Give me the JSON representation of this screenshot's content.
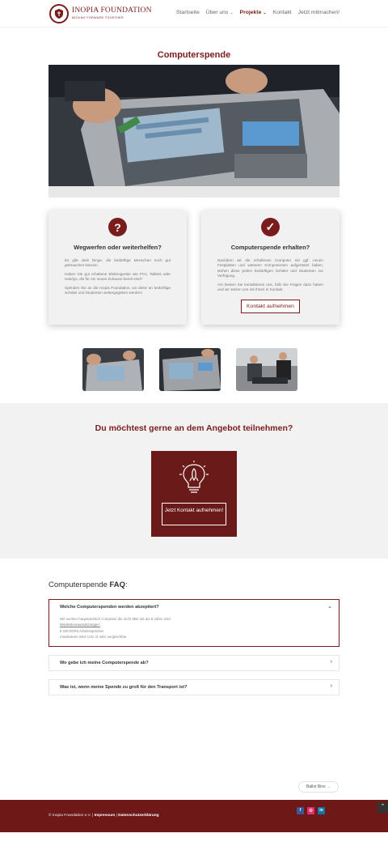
{
  "header": {
    "logo_title": "INOPIA FOUNDATION",
    "logo_subtitle": "MOVING FORWARD TOGETHER",
    "nav": [
      "Startseite",
      "Über uns",
      "Projekte",
      "Kontakt",
      "Jetzt mitmachen!"
    ]
  },
  "page_title": "Computerspende",
  "cards": {
    "left": {
      "icon": "question-icon",
      "title": "Wegwerfen oder weiterhelfen?",
      "p1": "Es gibt viele Dinge, die bedürftige Menschen noch gut gebrauchen können.",
      "p2": "Haben Sie gut erhaltene Elektrogeräte wie PCs, Tablets oder Handys, die für ein neues Zuhause bereit sind?",
      "p3": "Spenden Sie an die Inopia Foundation, wo diese an bedürftige Schüler und Studenten weitergegeben werden!"
    },
    "right": {
      "icon": "check-icon",
      "title": "Computerspende erhalten?",
      "p1": "Nachdem wir die erhaltenen Computer mit ggf. neuen Festplatten und weiteren Komponenten aufgerüstet haben, stehen diese jedem bedürftigen Schüler und Studenten zur Verfügung.",
      "p2": "Am besten Sie kontaktieren uns, falls Sie Fragen dazu haben und wir setzen uns mit Ihnen in Kontakt.",
      "button": "Kontakt aufnehmen"
    }
  },
  "cta": {
    "title": "Du möchtest gerne an dem Angebot teilnehmen?",
    "icon": "rocket-bulb-icon",
    "button": "Jetzt Kontakt aufnehmen!"
  },
  "faq": {
    "heading_plain": "Computerspende ",
    "heading_bold": "FAQ",
    "heading_colon": ":",
    "items": [
      {
        "question": "Welche Computerspenden werden akzeptiert?",
        "answer_line1": "Wir suchen hauptsächlich Computer die nicht älter als als 6 Jahre sind",
        "answer_link": "Mindestvoraussetzungen:",
        "answer_line3": "8 GB DDR3 Arbeitsspeicher",
        "answer_line4": "mindestens Intel Core i3 oder vergleichbar"
      },
      {
        "question": "Wo gebe ich meine Computerspende ab?"
      },
      {
        "question": "Was ist, wenn meine Spende zu groß für den Transport ist?"
      }
    ]
  },
  "ballot_label": "Ballot Bins →",
  "footer": {
    "copyright": "© Inopia Foundation e.V.",
    "sep1": " | ",
    "impressum": "Impressum",
    "sep2": " | ",
    "datenschutz": "Datenschutzerklärung",
    "socials": [
      "f",
      "◎",
      "in"
    ]
  },
  "colors": {
    "brand": "#7a1c1c",
    "footer": "#6e1818",
    "grey_section": "#f2f2f2"
  }
}
